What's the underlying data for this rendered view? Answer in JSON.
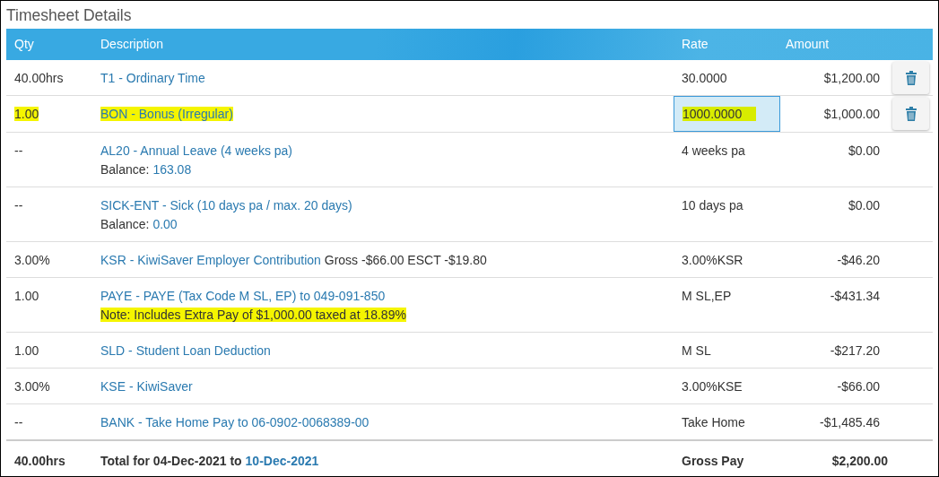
{
  "title": "Timesheet Details",
  "columns": [
    "Qty",
    "Description",
    "Rate",
    "Amount"
  ],
  "rows": [
    {
      "qty": "40.00hrs",
      "qty_highlighted": false,
      "description": "T1 - Ordinary Time",
      "description_highlighted": false,
      "rate": {
        "kind": "text",
        "value": "30.0000",
        "highlighted": false
      },
      "amount": "$1,200.00",
      "deletable": true
    },
    {
      "qty": "1.00",
      "qty_highlighted": true,
      "description": "BON - Bonus (Irregular)",
      "description_highlighted": true,
      "rate": {
        "kind": "input",
        "value": "1000.0000",
        "highlighted": true
      },
      "amount": "$1,000.00",
      "deletable": true
    },
    {
      "qty": "--",
      "qty_highlighted": false,
      "description": "AL20 - Annual Leave (4 weeks pa)",
      "description_highlighted": false,
      "balance": {
        "label": "Balance:",
        "value": "163.08"
      },
      "rate": {
        "kind": "text",
        "value": "4 weeks pa",
        "highlighted": false
      },
      "amount": "$0.00",
      "deletable": false
    },
    {
      "qty": "--",
      "qty_highlighted": false,
      "description": "SICK-ENT - Sick (10 days pa / max. 20 days)",
      "description_highlighted": false,
      "balance": {
        "label": "Balance:",
        "value": "0.00"
      },
      "rate": {
        "kind": "text",
        "value": "10 days pa",
        "highlighted": false
      },
      "amount": "$0.00",
      "deletable": false
    },
    {
      "qty": "3.00%",
      "qty_highlighted": false,
      "description": "KSR - KiwiSaver Employer Contribution",
      "description_highlighted": false,
      "description_extra": "Gross -$66.00 ESCT -$19.80",
      "rate": {
        "kind": "text",
        "value": "3.00%KSR",
        "highlighted": false
      },
      "amount": "-$46.20",
      "deletable": false
    },
    {
      "qty": "1.00",
      "qty_highlighted": false,
      "description": "PAYE - PAYE (Tax Code M SL, EP) to 049-091-850",
      "description_highlighted": false,
      "note": {
        "text": "Note: Includes Extra Pay of $1,000.00 taxed at 18.89%",
        "highlighted": true
      },
      "rate": {
        "kind": "text",
        "value": "M SL,EP",
        "highlighted": false
      },
      "amount": "-$431.34",
      "deletable": false
    },
    {
      "qty": "1.00",
      "qty_highlighted": false,
      "description": "SLD - Student Loan Deduction",
      "description_highlighted": false,
      "rate": {
        "kind": "text",
        "value": "M SL",
        "highlighted": false
      },
      "amount": "-$217.20",
      "deletable": false
    },
    {
      "qty": "3.00%",
      "qty_highlighted": false,
      "description": "KSE - KiwiSaver",
      "description_highlighted": false,
      "rate": {
        "kind": "text",
        "value": "3.00%KSE",
        "highlighted": false
      },
      "amount": "-$66.00",
      "deletable": false
    },
    {
      "qty": "--",
      "qty_highlighted": false,
      "description": "BANK - Take Home Pay to 06-0902-0068389-00",
      "description_highlighted": false,
      "rate": {
        "kind": "text",
        "value": "Take Home",
        "highlighted": false
      },
      "amount": "-$1,485.46",
      "deletable": false
    }
  ],
  "footer": {
    "qty": "40.00hrs",
    "period_text": "Total for 04-Dec-2021 to",
    "period_end": "10-Dec-2021",
    "rate": "Gross Pay",
    "amount": "$2,200.00"
  }
}
